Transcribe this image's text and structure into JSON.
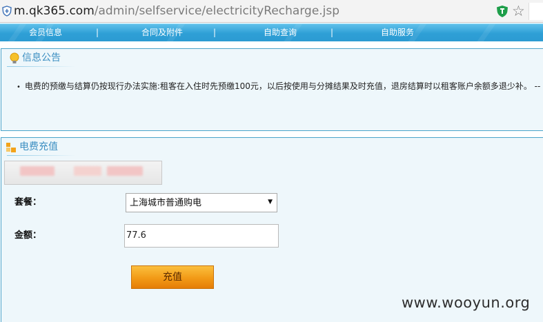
{
  "address_bar": {
    "host": "m.qk365.com",
    "path": "/admin/selfservice/electricityRecharge.jsp"
  },
  "nav": {
    "items": [
      "会员信息",
      "合同及附件",
      "自助查询",
      "自助服务"
    ],
    "separator": "|"
  },
  "notice": {
    "title": "信息公告",
    "bullet": "•",
    "text": "电费的预缴与结算仍按现行办法实施:租客在入住时先预缴100元，以后按使用与分摊结果及时充值，退房结算时以租客账户余额多退少补。 --"
  },
  "recharge": {
    "title": "电费充值",
    "package_label": "套餐：",
    "package_value": "上海城市普通购电",
    "amount_label": "金额：",
    "amount_value": "77.6",
    "submit_label": "充值"
  },
  "watermark": "www.wooyun.org",
  "colors": {
    "nav_bg": "#2e9fd6",
    "panel_border": "#4aa3c9",
    "panel_bg": "#eef7fb",
    "title_color": "#3c8fc2",
    "button_orange": "#f29a16"
  }
}
